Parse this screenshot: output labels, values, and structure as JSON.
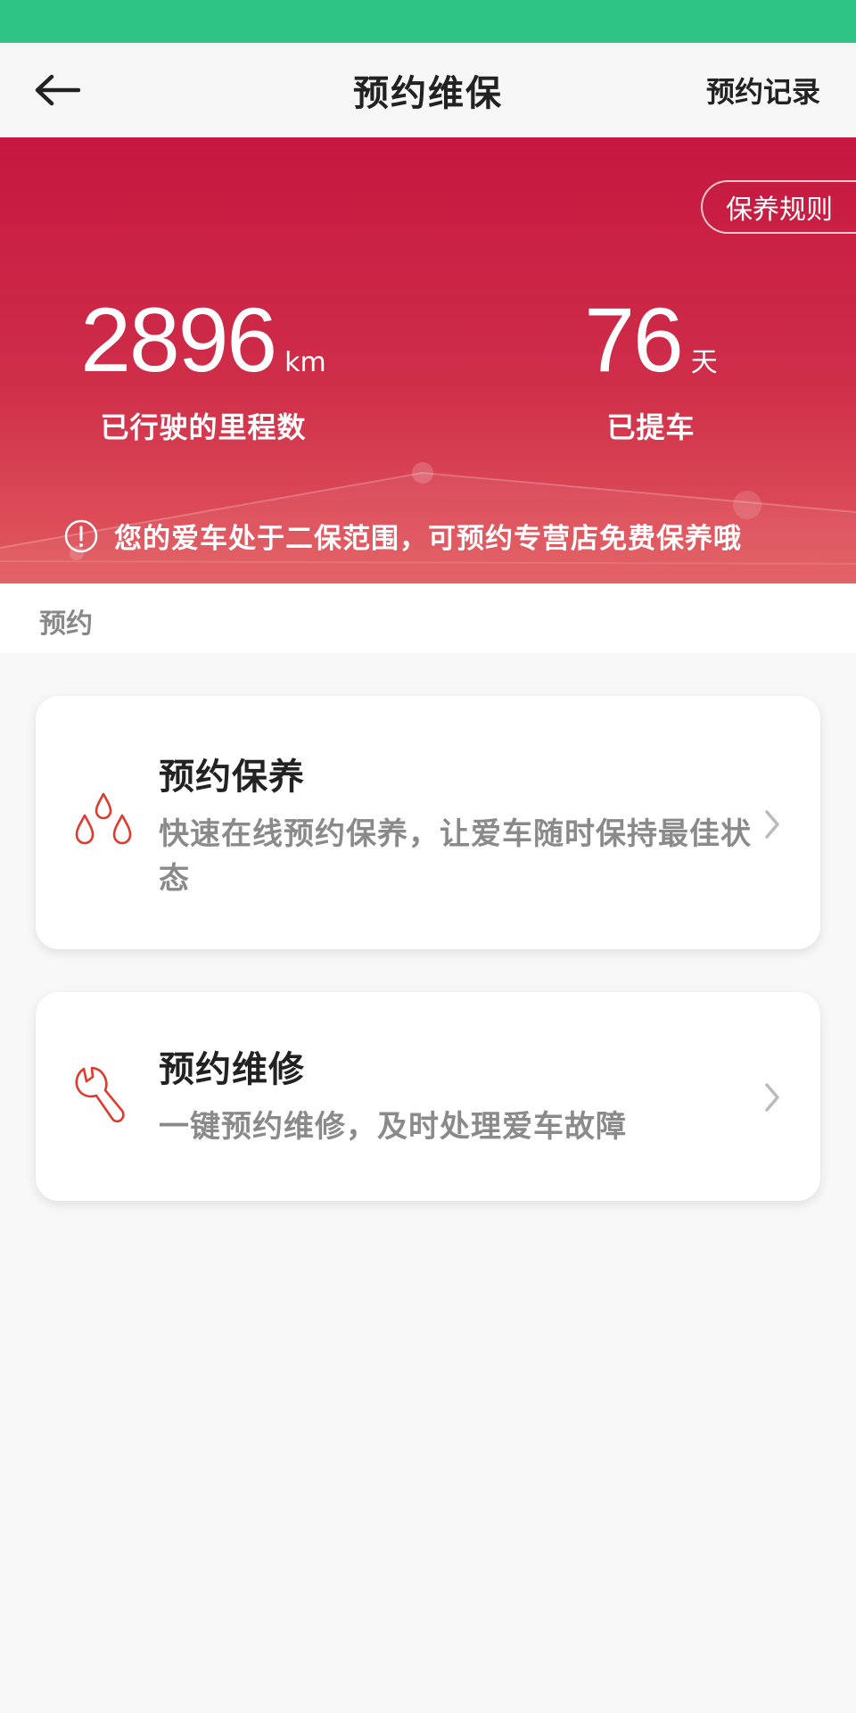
{
  "nav": {
    "title": "预约维保",
    "right_action": "预约记录"
  },
  "hero": {
    "rules_button": "保养规则",
    "mileage": {
      "value": "2896",
      "unit": "km",
      "label": "已行驶的里程数"
    },
    "days": {
      "value": "76",
      "unit": "天",
      "label": "已提车"
    },
    "notice": "您的爱车处于二保范围，可预约专营店免费保养哦"
  },
  "section": {
    "title": "预约"
  },
  "cards": [
    {
      "title": "预约保养",
      "desc": "快速在线预约保养，让爱车随时保持最佳状态",
      "icon": "oil-drops-icon"
    },
    {
      "title": "预约维修",
      "desc": "一键预约维修，及时处理爱车故障",
      "icon": "wrench-icon"
    }
  ],
  "colors": {
    "status_bar": "#2ec486",
    "hero_top": "#c51740",
    "hero_bottom": "#e25a5e",
    "accent_icon": "#e03a2f"
  }
}
